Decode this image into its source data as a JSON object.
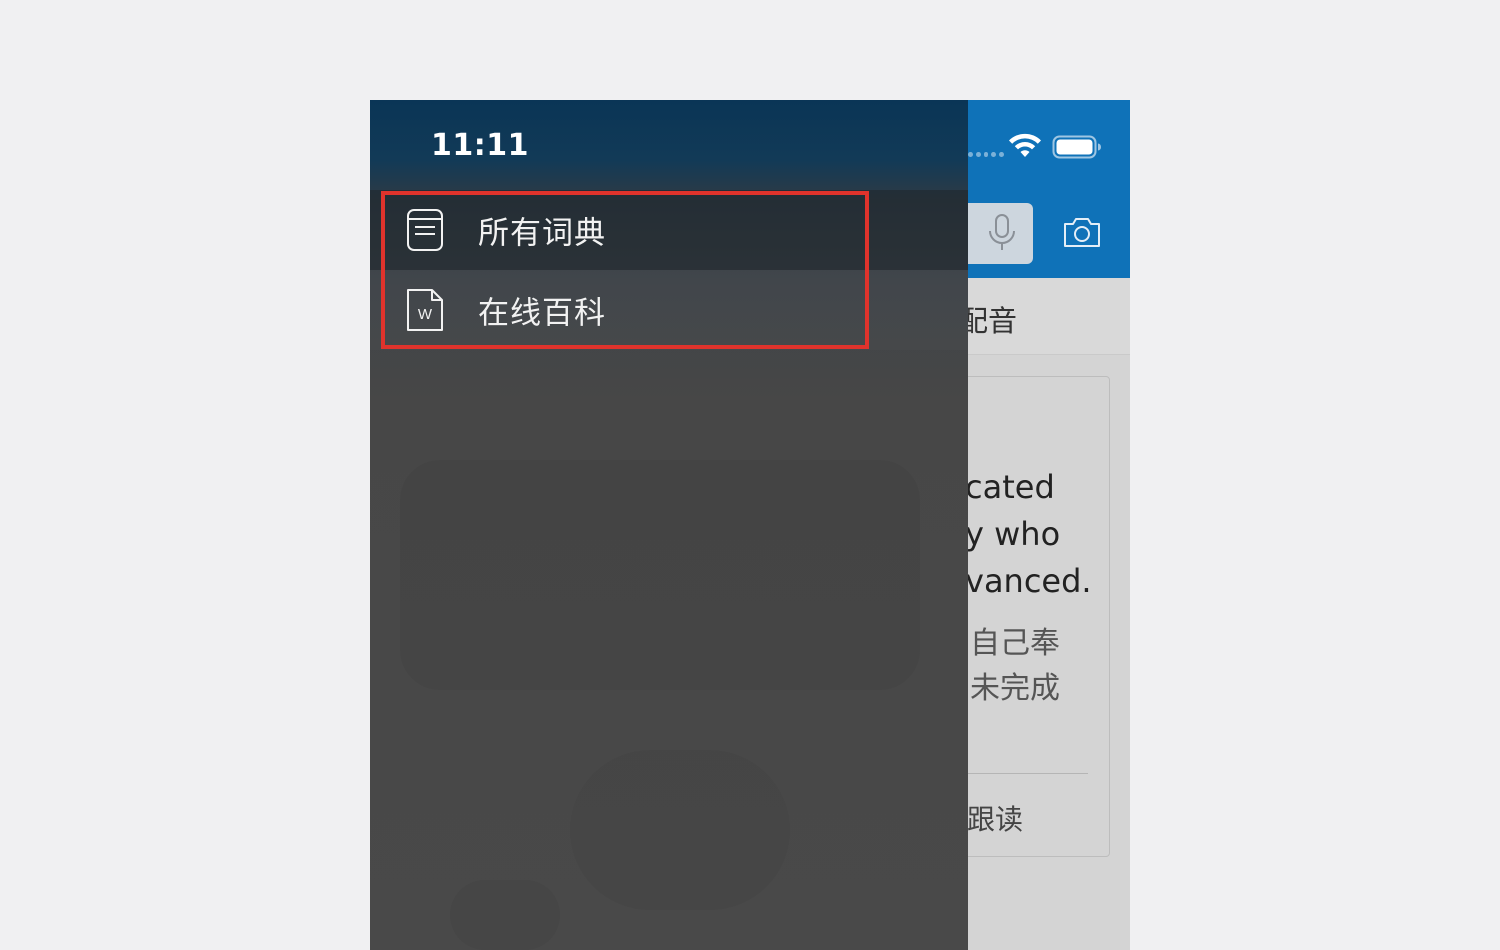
{
  "status_bar": {
    "time": "11:11"
  },
  "drawer": {
    "items": [
      {
        "label": "所有词典",
        "icon": "dictionary-book-icon"
      },
      {
        "label": "在线百科",
        "icon": "wiki-document-icon",
        "icon_letter": "W"
      }
    ],
    "highlight_color": "#e0332c"
  },
  "background_app": {
    "tab_label": "热门配音",
    "tab_label_visible": "门配音",
    "card_lines_en": [
      "cated",
      "y who",
      "vanced."
    ],
    "card_lines_zh": [
      "自己奉",
      "未完成"
    ],
    "follow_read": "跟读"
  },
  "colors": {
    "header_blue": "#0f72b8",
    "drawer_top": "#0a3556",
    "drawer_body": "#494949"
  }
}
